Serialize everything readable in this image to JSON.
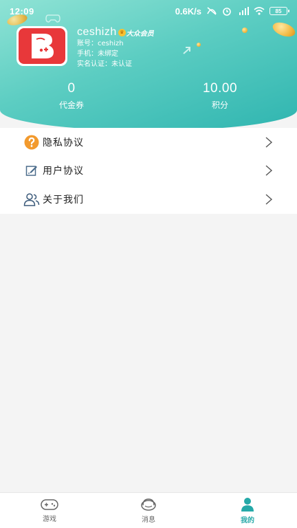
{
  "status_bar": {
    "time": "12:09",
    "speed": "0.6K/s",
    "battery": "85"
  },
  "profile": {
    "username": "ceshizh",
    "vip_badge": "大众会员",
    "account_line": "账号：ceshizh",
    "phone_line": "手机：未绑定",
    "realname_line": "实名认证：未认证"
  },
  "stats": [
    {
      "value": "0",
      "label": "代金券"
    },
    {
      "value": "10.00",
      "label": "积分"
    }
  ],
  "menu": [
    {
      "label": "隐私协议",
      "icon": "question-icon"
    },
    {
      "label": "用户协议",
      "icon": "edit-icon"
    },
    {
      "label": "关于我们",
      "icon": "users-icon"
    }
  ],
  "bottom_nav": [
    {
      "label": "游戏",
      "icon": "gamepad-icon",
      "active": false
    },
    {
      "label": "消息",
      "icon": "headset-icon",
      "active": false
    },
    {
      "label": "我的",
      "icon": "person-icon",
      "active": true
    }
  ],
  "colors": {
    "header_gradient_start": "#8fe3d5",
    "header_gradient_end": "#2fb5b0",
    "active_tab": "#25a9a8",
    "privacy_icon": "#f29a2e",
    "avatar_bg": "#e8383a"
  }
}
